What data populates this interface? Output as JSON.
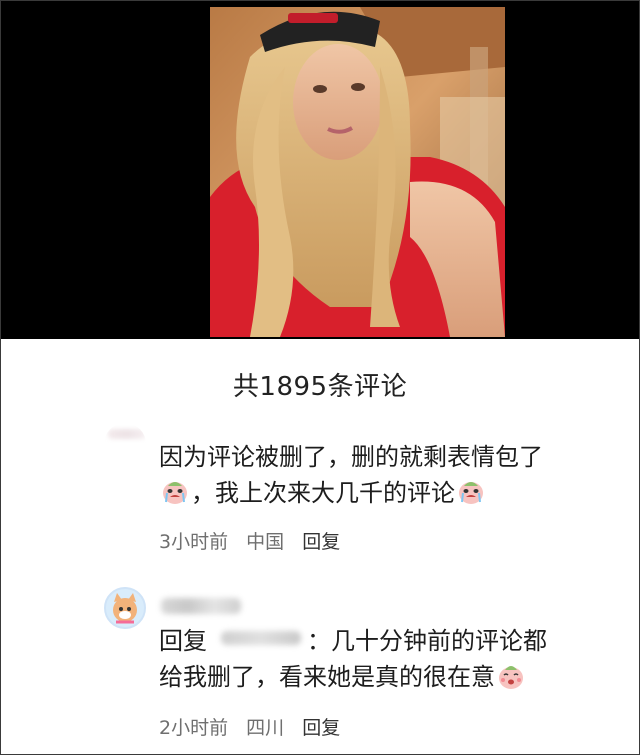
{
  "comments_header": {
    "count_text": "共1895条评论"
  },
  "comments": [
    {
      "avatar": "blurred-avatar",
      "text_part1": "因为评论被删了，删的就剩表情包了",
      "text_part2": "，我上次来大几千的评论",
      "emoji": "crying-face-emoji",
      "time": "3小时前",
      "location": "中国",
      "reply_label": "回复"
    },
    {
      "avatar": "cat-avatar",
      "reply_prefix": "回复",
      "text_part1": "：几十分钟前的评论都",
      "text_part2": "给我删了，看来她是真的很在意",
      "emoji": "shy-face-emoji",
      "time": "2小时前",
      "location": "四川",
      "reply_label": "回复"
    }
  ],
  "colors": {
    "background": "#ffffff",
    "text": "#1d1d1d",
    "meta": "#6f6f6f",
    "letterbox": "#000000"
  }
}
